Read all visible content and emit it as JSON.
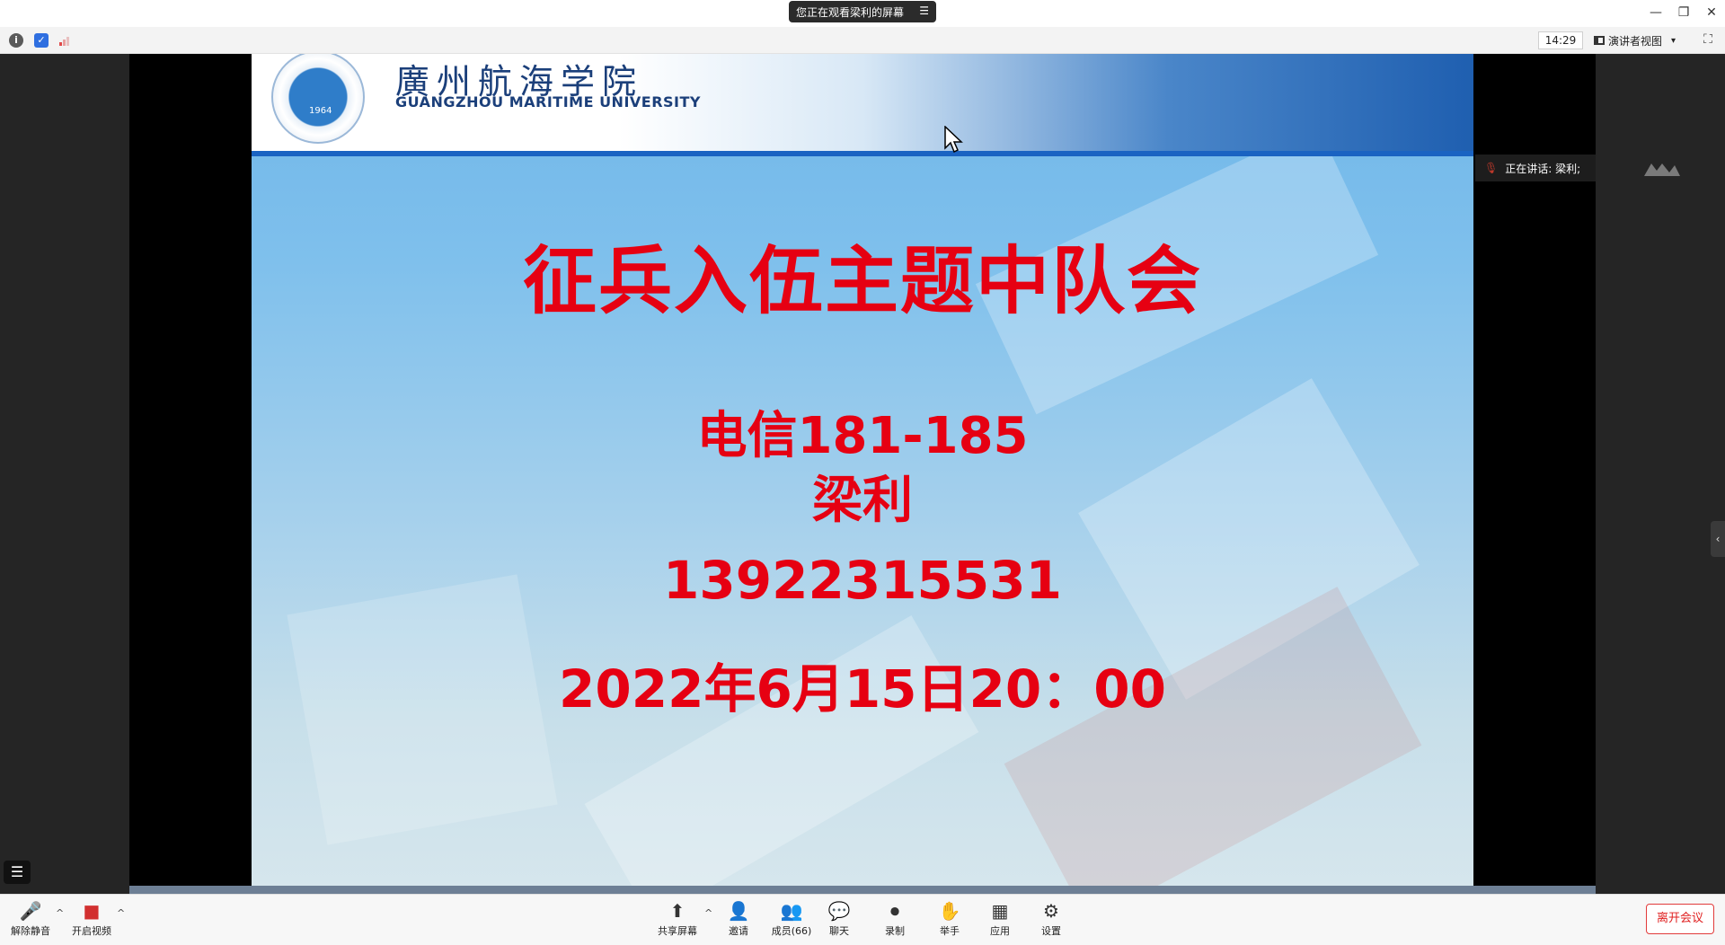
{
  "window": {
    "share_banner": "您正在观看梁利的屏幕",
    "share_menu_icon": "menu-lines-icon",
    "minimize": "—",
    "restore": "❐",
    "close": "✕"
  },
  "infobar": {
    "clock": "14:29",
    "view_mode": "演讲者视图",
    "view_mode_caret": "▾",
    "info_icon": "i",
    "shield_icon": "✓"
  },
  "slide": {
    "university_cn": "廣州航海学院",
    "university_en": "GUANGZHOU MARITIME UNIVERSITY",
    "logo_year": "1964",
    "title": "征兵入伍主题中队会",
    "class": "电信181-185",
    "name": "梁利",
    "phone": "13922315531",
    "datetime": "2022年6月15日20：00"
  },
  "speaker": {
    "label": "正在讲话: 梁利;"
  },
  "toolbar": {
    "unmute": "解除静音",
    "start_video": "开启视频",
    "share_screen": "共享屏幕",
    "invite": "邀请",
    "participants": "成员(66)",
    "chat": "聊天",
    "record": "录制",
    "raise_hand": "举手",
    "apps": "应用",
    "settings": "设置",
    "leave": "离开会议"
  },
  "colors": {
    "slide_text": "#e60012",
    "leave_button": "#e02020",
    "title_bar": "#ffffff",
    "stage_bg": "#252525"
  }
}
